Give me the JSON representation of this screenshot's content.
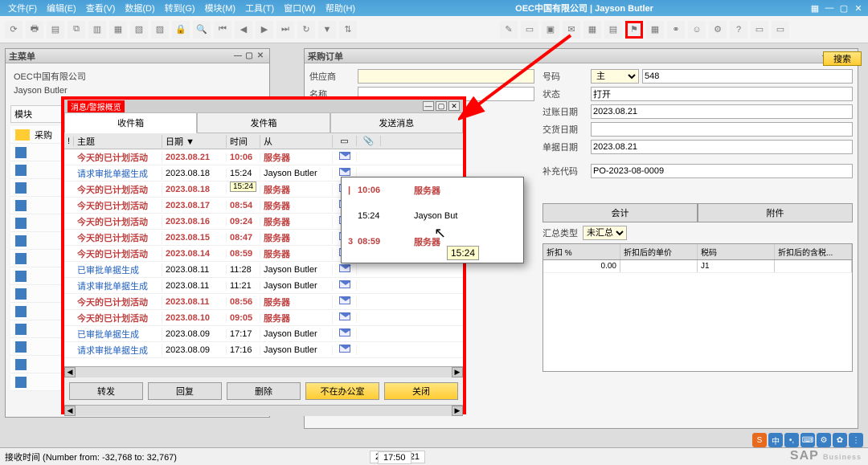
{
  "menubar": {
    "items": [
      "文件(F)",
      "编辑(E)",
      "查看(V)",
      "数据(D)",
      "转到(G)",
      "模块(M)",
      "工具(T)",
      "窗口(W)",
      "帮助(H)"
    ],
    "title": "OEC中国有限公司 | Jayson Butler"
  },
  "main_menu": {
    "title": "主菜单",
    "company": "OEC中国有限公司",
    "user": "Jayson Butler",
    "module_label": "模块",
    "active_module": "采购"
  },
  "po": {
    "title": "采购订单",
    "vendor_label": "供应商",
    "name_label": "名称",
    "no_label": "号码",
    "no_type": "主",
    "no_value": "548",
    "status_label": "状态",
    "status_value": "打开",
    "posting_label": "过账日期",
    "posting_value": "2023.08.21",
    "delivery_label": "交货日期",
    "doc_label": "单据日期",
    "doc_value": "2023.08.21",
    "ref_label": "补充代码",
    "ref_value": "PO-2023-08-0009",
    "tabs": [
      "会计",
      "附件"
    ],
    "summary_label": "汇总类型",
    "summary_value": "未汇总",
    "grid": {
      "cols": [
        "折扣 %",
        "折扣后的单价",
        "税码",
        "折扣后的含税..."
      ],
      "row1": {
        "discount": "0.00",
        "tax": "J1"
      }
    },
    "search_btn": "搜索"
  },
  "msg": {
    "title": "消息/警报概览",
    "tabs": [
      "收件箱",
      "发件箱",
      "发送消息"
    ],
    "columns": {
      "subject": "主题",
      "date": "日期",
      "time": "时间",
      "from": "从"
    },
    "rows": [
      {
        "subject": "今天的已计划活动",
        "date": "2023.08.21",
        "time": "10:06",
        "from": "服务器",
        "bold": true
      },
      {
        "subject": "请求审批单据生成",
        "date": "2023.08.18",
        "time": "15:24",
        "from": "Jayson Butler",
        "bold": false
      },
      {
        "subject": "今天的已计划活动",
        "date": "2023.08.18",
        "time": "08:59",
        "from": "服务器",
        "bold": true
      },
      {
        "subject": "今天的已计划活动",
        "date": "2023.08.17",
        "time": "08:54",
        "from": "服务器",
        "bold": true
      },
      {
        "subject": "今天的已计划活动",
        "date": "2023.08.16",
        "time": "09:24",
        "from": "服务器",
        "bold": true
      },
      {
        "subject": "今天的已计划活动",
        "date": "2023.08.15",
        "time": "08:47",
        "from": "服务器",
        "bold": true
      },
      {
        "subject": "今天的已计划活动",
        "date": "2023.08.14",
        "time": "08:59",
        "from": "服务器",
        "bold": true
      },
      {
        "subject": "已审批单据生成",
        "date": "2023.08.11",
        "time": "11:28",
        "from": "Jayson Butler",
        "bold": false
      },
      {
        "subject": "请求审批单据生成",
        "date": "2023.08.11",
        "time": "11:21",
        "from": "Jayson Butler",
        "bold": false
      },
      {
        "subject": "今天的已计划活动",
        "date": "2023.08.11",
        "time": "08:56",
        "from": "服务器",
        "bold": true
      },
      {
        "subject": "今天的已计划活动",
        "date": "2023.08.10",
        "time": "09:05",
        "from": "服务器",
        "bold": true
      },
      {
        "subject": "已审批单据生成",
        "date": "2023.08.09",
        "time": "17:17",
        "from": "Jayson Butler",
        "bold": false
      },
      {
        "subject": "请求审批单据生成",
        "date": "2023.08.09",
        "time": "17:16",
        "from": "Jayson Butler",
        "bold": false
      }
    ],
    "tooltip": "15:24",
    "buttons": {
      "forward": "转发",
      "reply": "回复",
      "delete": "删除",
      "away": "不在办公室",
      "close": "关闭"
    }
  },
  "zoom": {
    "rows": [
      {
        "time": "10:06",
        "from": "服务器",
        "bold": true
      },
      {
        "time": "15:24",
        "from": "Jayson But",
        "bold": false
      },
      {
        "time": "08:59",
        "from": "服务器",
        "bold": true
      }
    ],
    "tip": "15:24"
  },
  "statusbar": {
    "hint": "接收时间 (Number from: -32,768 to: 32,767)",
    "date": "2023.08.21",
    "time": "17:50"
  }
}
